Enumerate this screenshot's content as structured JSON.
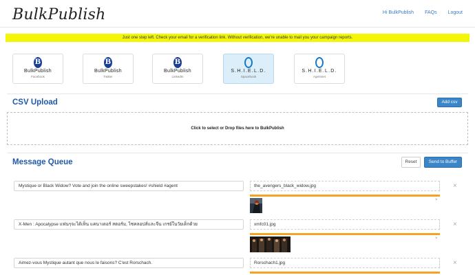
{
  "app": {
    "logo": "BulkPublish"
  },
  "nav": {
    "greeting": "Hi BulkPublish",
    "faqs": "FAQs",
    "logout": "Logout"
  },
  "banner": {
    "text": "Just one step left. Check your email for a verification link. Without verification, we're unable to mail you your campaign reports."
  },
  "profiles": [
    {
      "name": "BulkPublish",
      "network": "Facebook",
      "icon": "bulkpublish-logo",
      "active": false
    },
    {
      "name": "BulkPublish",
      "network": "Twitter",
      "icon": "bulkpublish-logo",
      "active": false
    },
    {
      "name": "BulkPublish",
      "network": "LinkedIn",
      "icon": "bulkpublish-logo",
      "active": false
    },
    {
      "name": "S.H.I.E.L.D.",
      "network": "Spacebook",
      "icon": "shield-logo",
      "active": true
    },
    {
      "name": "S.H.I.E.L.D.",
      "network": "Agentnet",
      "icon": "shield-logo",
      "active": false
    }
  ],
  "csv": {
    "title": "CSV Upload",
    "add_label": "Add csv",
    "dropzone_text": "Click to select or Drop files here to BulkPublish"
  },
  "queue": {
    "title": "Message Queue",
    "reset_label": "Reset",
    "send_label": "Send to Buffer",
    "items": [
      {
        "message": "Mystique or Black Widow? Vote and join the online sweepstakes! #shield #agent",
        "file": "the_avengers_black_widow.jpg",
        "remove": "×",
        "thumb_remove": "×"
      },
      {
        "message": "X-Men : Apocalypse แฟนๆจะได้เห็น แคนาเดอร์ สตอร์ม, ไซคลอปส์และจีน เกรย์ในวัยเด็กด้วย",
        "file": "xmfc01.jpg",
        "remove": "×",
        "thumb_remove": "×"
      },
      {
        "message": "Aimez-vous Mystique autant que nous le faisons? C'est Rorschach.",
        "file": "Rorschach1.jpg",
        "remove": "×"
      }
    ]
  },
  "colors": {
    "accent": "#1f5aa8",
    "button": "#3b86c8",
    "banner": "#f4f60a",
    "progress": "#f4a21f",
    "active_profile": "#dbeefa"
  }
}
